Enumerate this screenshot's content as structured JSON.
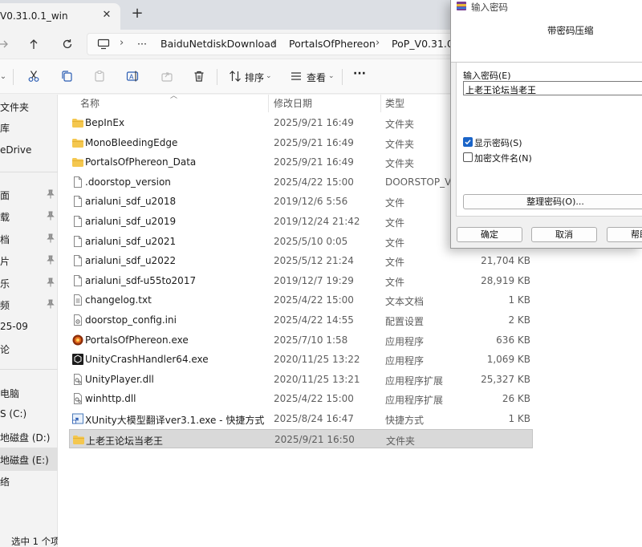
{
  "tab": {
    "title": "V0.31.0.1_win",
    "close": "✕",
    "new": "+"
  },
  "breadcrumb": {
    "more": "···",
    "items": [
      "BaiduNetdiskDownload",
      "PortalsOfPhereon",
      "PoP_V0.31.0.1"
    ]
  },
  "toolbar": {
    "sort_label": "排序",
    "view_label": "查看",
    "more": "···"
  },
  "sidebar": {
    "items": [
      {
        "label": "文件夹",
        "pinned": false
      },
      {
        "label": "库",
        "pinned": false
      },
      {
        "label": "eDrive",
        "pinned": false
      },
      {
        "label": "面",
        "pinned": true
      },
      {
        "label": "载",
        "pinned": true
      },
      {
        "label": "档",
        "pinned": true
      },
      {
        "label": "片",
        "pinned": true
      },
      {
        "label": "乐",
        "pinned": true
      },
      {
        "label": "频",
        "pinned": true
      },
      {
        "label": "25-09",
        "pinned": false
      },
      {
        "label": "论",
        "pinned": false
      },
      {
        "label": "电脑",
        "pinned": false
      },
      {
        "label": "S (C:)",
        "pinned": false
      },
      {
        "label": "地磁盘 (D:)",
        "pinned": false
      },
      {
        "label": "地磁盘 (E:)",
        "pinned": false
      },
      {
        "label": "络",
        "pinned": false
      }
    ],
    "selected_index": 14
  },
  "status": "选中 1 个项目",
  "columns": {
    "name": "名称",
    "date": "修改日期",
    "type": "类型"
  },
  "files": [
    {
      "name": "BepInEx",
      "date": "2025/9/21 16:49",
      "type": "文件夹",
      "size": "",
      "icon": "folder-icon"
    },
    {
      "name": "MonoBleedingEdge",
      "date": "2025/9/21 16:49",
      "type": "文件夹",
      "size": "",
      "icon": "folder-icon"
    },
    {
      "name": "PortalsOfPhereon_Data",
      "date": "2025/9/21 16:49",
      "type": "文件夹",
      "size": "",
      "icon": "folder-icon"
    },
    {
      "name": ".doorstop_version",
      "date": "2025/4/22 15:00",
      "type": "DOORSTOP_VER",
      "size": "",
      "icon": "file-icon"
    },
    {
      "name": "arialuni_sdf_u2018",
      "date": "2019/12/6 5:56",
      "type": "文件",
      "size": "",
      "icon": "file-icon"
    },
    {
      "name": "arialuni_sdf_u2019",
      "date": "2019/12/24 21:42",
      "type": "文件",
      "size": "",
      "icon": "file-icon"
    },
    {
      "name": "arialuni_sdf_u2021",
      "date": "2025/5/10 0:05",
      "type": "文件",
      "size": "",
      "icon": "file-icon"
    },
    {
      "name": "arialuni_sdf_u2022",
      "date": "2025/5/12 21:24",
      "type": "文件",
      "size": "21,704 KB",
      "icon": "file-icon"
    },
    {
      "name": "arialuni_sdf-u55to2017",
      "date": "2019/12/7 19:29",
      "type": "文件",
      "size": "28,919 KB",
      "icon": "file-icon"
    },
    {
      "name": "changelog.txt",
      "date": "2025/4/22 15:00",
      "type": "文本文档",
      "size": "1 KB",
      "icon": "text-file-icon"
    },
    {
      "name": "doorstop_config.ini",
      "date": "2025/4/22 14:55",
      "type": "配置设置",
      "size": "2 KB",
      "icon": "settings-file-icon"
    },
    {
      "name": "PortalsOfPhereon.exe",
      "date": "2025/7/10 1:58",
      "type": "应用程序",
      "size": "636 KB",
      "icon": "game-exe-icon"
    },
    {
      "name": "UnityCrashHandler64.exe",
      "date": "2020/11/25 13:22",
      "type": "应用程序",
      "size": "1,069 KB",
      "icon": "unity-exe-icon"
    },
    {
      "name": "UnityPlayer.dll",
      "date": "2020/11/25 13:21",
      "type": "应用程序扩展",
      "size": "25,327 KB",
      "icon": "dll-file-icon"
    },
    {
      "name": "winhttp.dll",
      "date": "2025/4/22 15:00",
      "type": "应用程序扩展",
      "size": "26 KB",
      "icon": "dll-file-icon"
    },
    {
      "name": "XUnity大模型翻译ver3.1.exe - 快捷方式",
      "date": "2025/8/24 16:47",
      "type": "快捷方式",
      "size": "1 KB",
      "icon": "shortcut-icon"
    },
    {
      "name": "上老王论坛当老王",
      "date": "2025/9/21 16:50",
      "type": "文件夹",
      "size": "",
      "icon": "folder-icon"
    }
  ],
  "selected_file_index": 16,
  "dialog": {
    "title": "输入密码",
    "tab": "带密码压缩",
    "password_label": "输入密码(E)",
    "password_value": "上老王论坛当老王",
    "show_password_label": "显示密码(S)",
    "show_password_checked": true,
    "encrypt_names_label": "加密文件名(N)",
    "encrypt_names_checked": false,
    "organize_button": "整理密码(O)...",
    "ok_button": "确定",
    "cancel_button": "取消",
    "help_button": "帮助"
  },
  "colors": {
    "folder": "#f4c74f",
    "accent": "#1a64c8",
    "selection": "#d9d9d9"
  }
}
